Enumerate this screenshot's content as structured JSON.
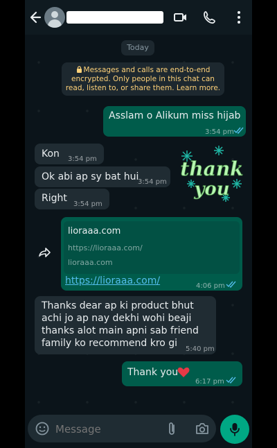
{
  "header": {
    "contact_name": ""
  },
  "chat": {
    "day_label": "Today",
    "encryption_notice": "Messages and calls are end-to-end encrypted. Only people in this chat can read, listen to, or share them. Learn more.",
    "messages": [
      {
        "text": "Asslam o Alikum miss hijab",
        "time": "3:54 pm"
      },
      {
        "text": "Kon",
        "time": "3:54 pm"
      },
      {
        "text": "Ok abi ap sy bat hui",
        "time": "3:54 pm"
      },
      {
        "text": "Right",
        "time": "3:54 pm"
      },
      {
        "link_title": "lioraaa.com",
        "link_url_line": "https://lioraaa.com/",
        "link_domain": "lioraaa.com",
        "link_text": "https://lioraaa.com/",
        "time": "4:06 pm"
      },
      {
        "text": "Thanks dear ap ki product bhut achi jo ap nay dekhi wohi beaji thanks alot main apni sab friend family  ko recommend kro gi",
        "time": "5:40 pm"
      },
      {
        "text": "Thank you",
        "time": "6:17 pm"
      }
    ],
    "sticker_text_top": "thank",
    "sticker_text_bottom": "you"
  },
  "composer": {
    "placeholder": "Message"
  },
  "colors": {
    "outgoing": "#005c4b",
    "incoming": "#202c33",
    "accent": "#00a884",
    "read_ticks": "#53bdeb"
  },
  "icons": [
    "back-arrow-icon",
    "video-call-icon",
    "phone-icon",
    "more-options-icon",
    "lock-icon",
    "forward-icon",
    "emoji-icon",
    "attach-icon",
    "camera-icon",
    "mic-icon",
    "heart-icon"
  ]
}
